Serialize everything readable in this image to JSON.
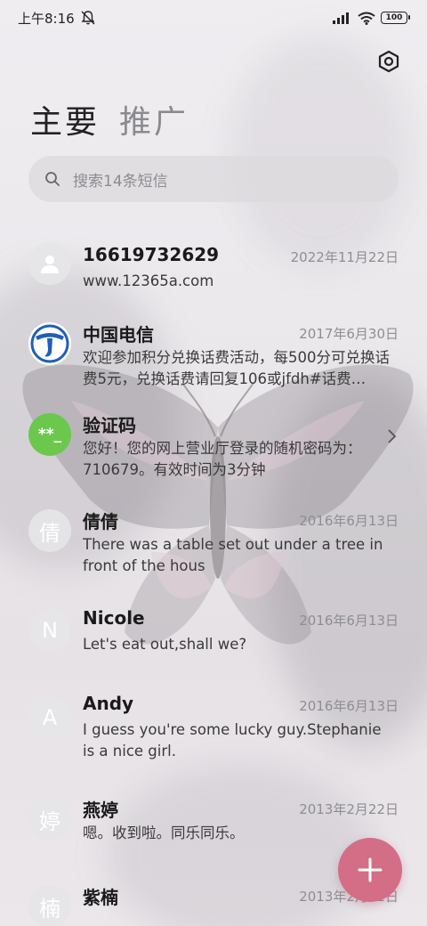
{
  "status_bar": {
    "time": "上午8:16",
    "battery": "100"
  },
  "tabs": {
    "main": "主要",
    "promo": "推广"
  },
  "search": {
    "placeholder": "搜索14条短信"
  },
  "messages": [
    {
      "name": "16619732629",
      "date": "2022年11月22日",
      "preview": "www.12365a.com",
      "avatar": "person-icon"
    },
    {
      "name": "中国电信",
      "date": "2017年6月30日",
      "preview": "欢迎参加积分兑换话费活动，每500分可兑换话费5元，兑换话费请回复106或jfdh#话费…",
      "avatar": "china-telecom-logo"
    },
    {
      "name": "验证码",
      "date": "",
      "preview": "您好！您的网上营业厅登录的随机密码为：710679。有效时间为3分钟",
      "avatar_text": "**_"
    },
    {
      "name": "倩倩",
      "date": "2016年6月13日",
      "preview": "There was a table set out under a tree in front of the hous",
      "avatar_text": "倩"
    },
    {
      "name": "Nicole",
      "date": "2016年6月13日",
      "preview": "Let's eat out,shall we?",
      "avatar_text": "N"
    },
    {
      "name": "Andy",
      "date": "2016年6月13日",
      "preview": "I guess you're some lucky guy.Stephanie is a nice girl.",
      "avatar_text": "A"
    },
    {
      "name": "燕婷",
      "date": "2013年2月22日",
      "preview": "嗯。收到啦。同乐同乐。",
      "avatar_text": "婷"
    },
    {
      "name": "紫楠",
      "date": "2013年2月22日",
      "preview": "",
      "avatar_text": "楠"
    }
  ],
  "colors": {
    "fab": "#d46d86",
    "code_avatar": "#6cc84d",
    "telecom_blue": "#1f5fb8"
  }
}
